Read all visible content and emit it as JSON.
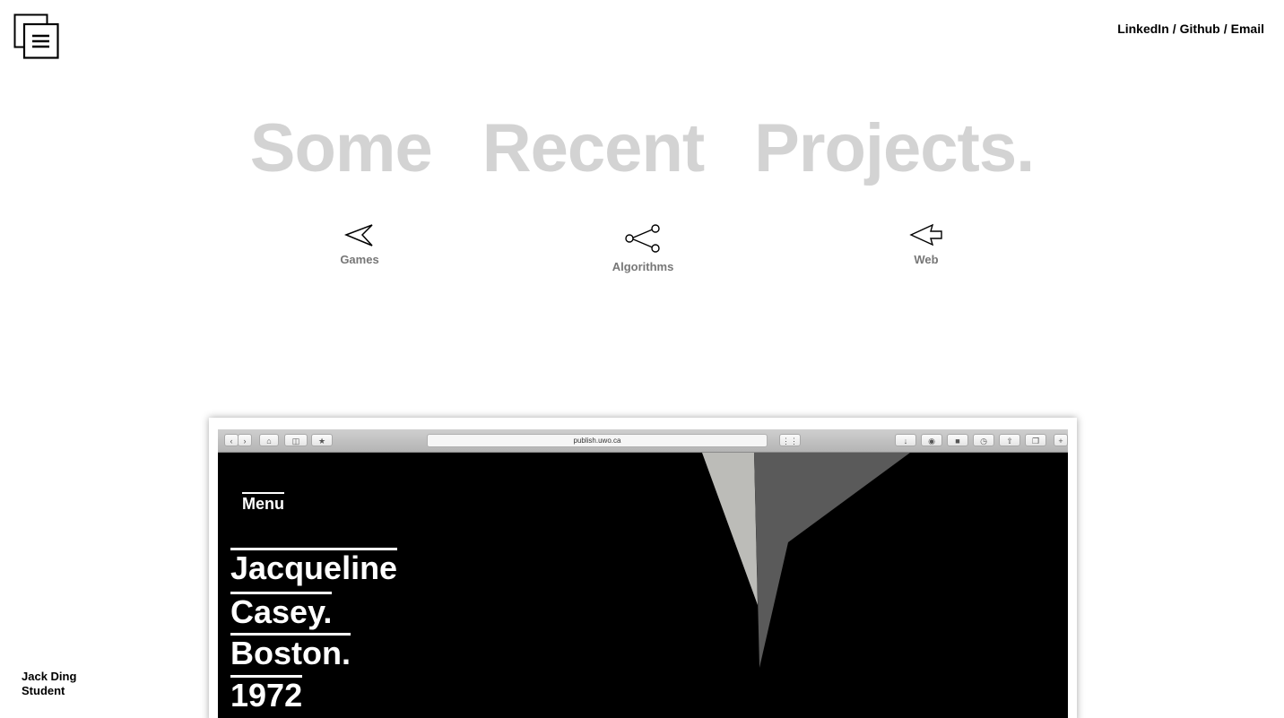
{
  "header": {
    "logo_icon": "menu-stacked-pages-icon",
    "social_links": [
      "LinkedIn",
      "Github",
      "Email"
    ],
    "separator": "/"
  },
  "headline": {
    "words": [
      "Some",
      "Recent",
      "Projects."
    ]
  },
  "categories": [
    {
      "label": "Games",
      "icon": "paper-plane-icon"
    },
    {
      "label": "Algorithms",
      "icon": "share-nodes-icon"
    },
    {
      "label": "Web",
      "icon": "arrow-pointer-icon"
    }
  ],
  "identity": {
    "name": "Jack Ding",
    "role": "Student"
  },
  "preview": {
    "url": "publish.uwo.ca",
    "site_menu": "Menu",
    "title_lines": [
      "Jacqueline",
      "Casey.",
      "Boston.",
      "1972"
    ],
    "colors": {
      "background": "#000000",
      "shape_light": "#bcbcb8",
      "shape_dark": "#5a5a5a"
    }
  }
}
